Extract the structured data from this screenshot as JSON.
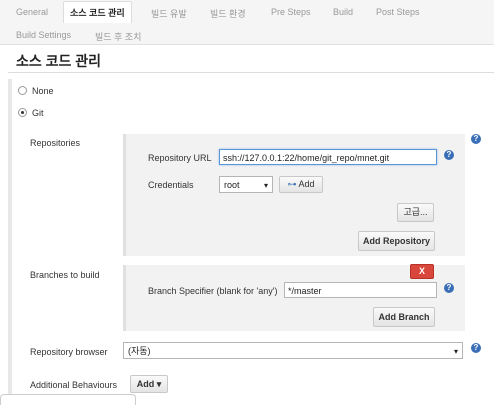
{
  "tabs": [
    "General",
    "소스 코드 관리",
    "빌드 유발",
    "빌드 환경",
    "Pre Steps",
    "Build",
    "Post Steps",
    "Build Settings",
    "빌드 후 조치"
  ],
  "section_title": "소스 코드 관리",
  "scm": {
    "none_label": "None",
    "git_label": "Git",
    "selected": "Git"
  },
  "repositories": {
    "label": "Repositories",
    "url_label": "Repository URL",
    "url_value": "ssh://127.0.0.1:22/home/git_repo/mnet.git",
    "credentials_label": "Credentials",
    "credentials_value": "root",
    "add_label": "Add",
    "advanced_label": "고급...",
    "add_repository_label": "Add Repository"
  },
  "branches": {
    "label": "Branches to build",
    "delete_label": "X",
    "specifier_label": "Branch Specifier (blank for 'any')",
    "specifier_value": "*/master",
    "add_branch_label": "Add Branch"
  },
  "repo_browser": {
    "label": "Repository browser",
    "value": "(자동)"
  },
  "behaviours": {
    "label": "Additional Behaviours",
    "add_label": "Add"
  },
  "help_glyph": "?",
  "dropdown_glyph": "▾",
  "colors": {
    "accent": "#3a6fb7",
    "delete": "#d9463b",
    "panel": "#f2f2f2"
  }
}
